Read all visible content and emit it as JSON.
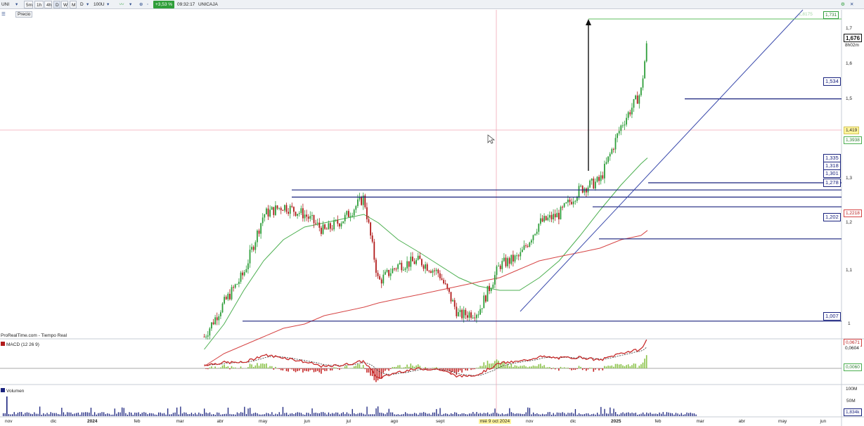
{
  "toolbar": {
    "symbol": "UNI",
    "timeframes": [
      "5m",
      "1h",
      "4h",
      "D",
      "W",
      "M"
    ],
    "period": "D",
    "units": "100U",
    "change": "+3,53 %",
    "time": "09:32:17",
    "instrument": "UNICAJA"
  },
  "chart_header": {
    "price_label": "Precio",
    "source_label": "ProRealTime.com - Tiempo Real"
  },
  "price_panel": {
    "last_price": "1,676",
    "countdown": "8h02m",
    "crosshair_value": "1,419",
    "ma_short_value": "1,3938",
    "ma_long_value": "1,2218",
    "target_value": "1,731",
    "target_ghost_value": "1,8175",
    "axis_ticks": [
      "1,7",
      "1,6",
      "1,5",
      "1,3",
      "1,2",
      "1,1",
      "1"
    ],
    "levels": [
      {
        "value": "1,534",
        "price": 1.534
      },
      {
        "value": "1,335",
        "price": 1.335
      },
      {
        "value": "1,318",
        "price": 1.318
      },
      {
        "value": "1,301",
        "price": 1.301
      },
      {
        "value": "1,278",
        "price": 1.278
      },
      {
        "value": "1,202",
        "price": 1.202
      },
      {
        "value": "1,007",
        "price": 1.007
      }
    ],
    "colors": {
      "up": "#2e9e3a",
      "down": "#b11b1b",
      "levels": "#1a237e",
      "ma_short": "#4caf50",
      "ma_long": "#d64545",
      "trendline": "#3949ab"
    }
  },
  "macd_panel": {
    "label": "MACD (12 26 9)",
    "values": [
      "0,0671",
      "0,0604",
      "0,0060"
    ]
  },
  "volume_panel": {
    "label": "Volumen",
    "ticks": [
      "100M",
      "50M",
      "1,834k"
    ]
  },
  "x_axis": {
    "labels": [
      "nov",
      "dic",
      "2024",
      "feb",
      "mar",
      "abr",
      "may",
      "jun",
      "jul",
      "ago",
      "sept",
      "mié 9 oct 2024",
      "nov",
      "dic",
      "2025",
      "feb",
      "mar",
      "abr",
      "may",
      "jun"
    ]
  },
  "chart_data": {
    "type": "line",
    "title": "UNICAJA",
    "series": [
      {
        "kind": "candlestick-close",
        "x": [
          "2024-03-26",
          "2024-04-10",
          "2024-04-25",
          "2024-05-10",
          "2024-05-25",
          "2024-06-10",
          "2024-06-25",
          "2024-07-10",
          "2024-07-25",
          "2024-08-05",
          "2024-08-20",
          "2024-09-05",
          "2024-09-20",
          "2024-10-05",
          "2024-10-20",
          "2024-11-05",
          "2024-11-20",
          "2024-12-05",
          "2024-12-20",
          "2025-01-05",
          "2025-01-20",
          "2025-02-05",
          "2025-02-20",
          "2025-02-25"
        ],
        "values": [
          0.97,
          1.05,
          1.12,
          1.26,
          1.28,
          1.26,
          1.22,
          1.25,
          1.3,
          1.1,
          1.14,
          1.15,
          1.12,
          1.02,
          1.03,
          1.14,
          1.16,
          1.24,
          1.26,
          1.32,
          1.34,
          1.47,
          1.55,
          1.676
        ]
      },
      {
        "name": "MA short",
        "values": [
          0.94,
          1.0,
          1.08,
          1.15,
          1.2,
          1.23,
          1.24,
          1.25,
          1.26,
          1.24,
          1.2,
          1.17,
          1.14,
          1.11,
          1.09,
          1.08,
          1.08,
          1.11,
          1.15,
          1.21,
          1.27,
          1.33,
          1.38,
          1.394
        ]
      },
      {
        "name": "MA long",
        "values": [
          0.9,
          0.93,
          0.95,
          0.97,
          0.99,
          1.0,
          1.02,
          1.03,
          1.04,
          1.05,
          1.06,
          1.07,
          1.08,
          1.09,
          1.1,
          1.11,
          1.13,
          1.15,
          1.16,
          1.17,
          1.18,
          1.2,
          1.21,
          1.222
        ]
      }
    ],
    "levels": [
      1.731,
      1.534,
      1.335,
      1.318,
      1.301,
      1.278,
      1.202,
      1.007
    ],
    "ylim": [
      0.98,
      1.74
    ],
    "xlabel": "",
    "ylabel": ""
  }
}
